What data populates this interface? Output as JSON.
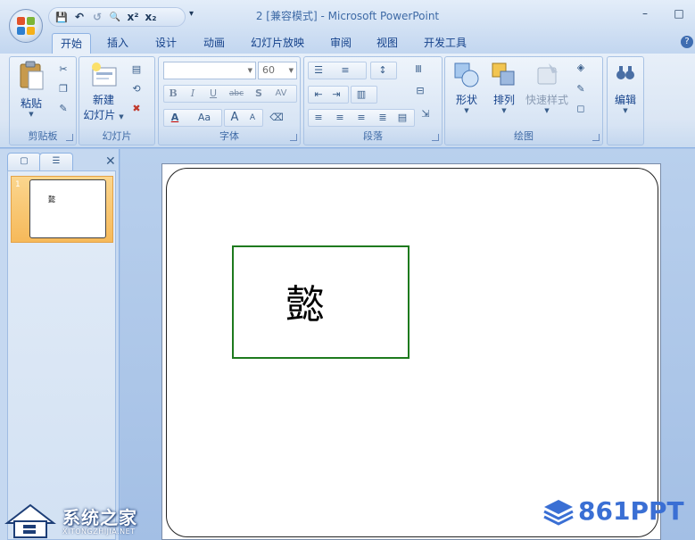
{
  "window": {
    "title": "2 [兼容模式] - Microsoft PowerPoint",
    "minimize": "–",
    "maximize": "□"
  },
  "quick_access": {
    "save": "💾",
    "undo": "↶",
    "redo": "↺",
    "print_preview": "🔍",
    "superscript": "x²",
    "subscript": "x₂",
    "more": "▾"
  },
  "tabs": [
    {
      "label": "开始",
      "active": true
    },
    {
      "label": "插入"
    },
    {
      "label": "设计"
    },
    {
      "label": "动画"
    },
    {
      "label": "幻灯片放映"
    },
    {
      "label": "审阅"
    },
    {
      "label": "视图"
    },
    {
      "label": "开发工具"
    }
  ],
  "help": "?",
  "ribbon": {
    "clipboard": {
      "label": "剪贴板",
      "paste": "粘贴"
    },
    "slides": {
      "label": "幻灯片",
      "new_slide_1": "新建",
      "new_slide_2": "幻灯片"
    },
    "font": {
      "label": "字体",
      "font_name": "",
      "font_size": "60",
      "bold": "B",
      "italic": "I",
      "underline": "U",
      "strike": "abc",
      "shadow": "S",
      "spacing": "AV",
      "font_color": "A",
      "change_case": "Aa",
      "grow": "A",
      "shrink": "A"
    },
    "paragraph": {
      "label": "段落"
    },
    "drawing": {
      "label": "绘图",
      "shapes": "形状",
      "arrange": "排列",
      "quick_styles": "快速样式"
    },
    "editing": {
      "label": "编辑"
    }
  },
  "slide_panel": {
    "slide_number": "1",
    "thumb_char": "懿"
  },
  "slide": {
    "text": "懿",
    "textbox_border_color": "#1e7a1e"
  },
  "watermarks": {
    "left_brand": "系统之家",
    "left_url": "XITONGZHIJIA.NET",
    "right_brand": "861PPT"
  }
}
